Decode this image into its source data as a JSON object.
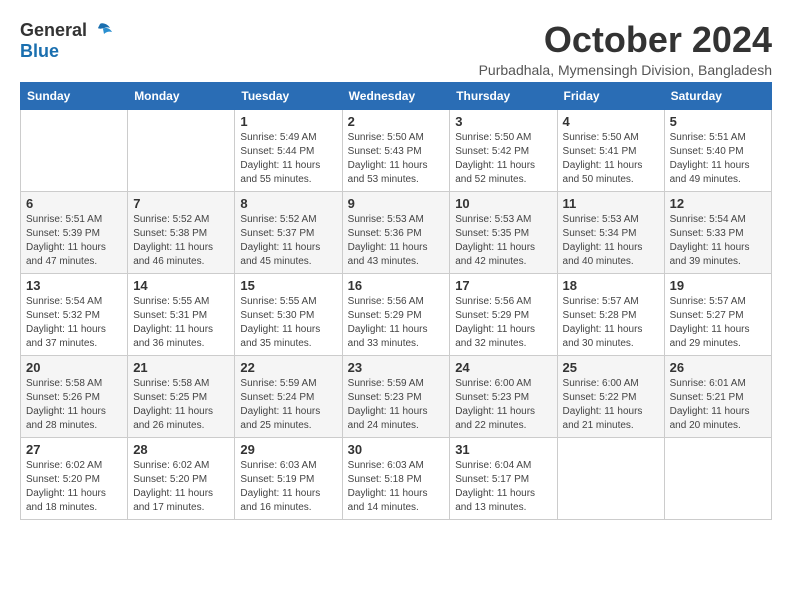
{
  "header": {
    "logo_general": "General",
    "logo_blue": "Blue",
    "month_title": "October 2024",
    "location": "Purbadhala, Mymensingh Division, Bangladesh"
  },
  "days_of_week": [
    "Sunday",
    "Monday",
    "Tuesday",
    "Wednesday",
    "Thursday",
    "Friday",
    "Saturday"
  ],
  "weeks": [
    [
      {
        "day": "",
        "info": ""
      },
      {
        "day": "",
        "info": ""
      },
      {
        "day": "1",
        "info": "Sunrise: 5:49 AM\nSunset: 5:44 PM\nDaylight: 11 hours\nand 55 minutes."
      },
      {
        "day": "2",
        "info": "Sunrise: 5:50 AM\nSunset: 5:43 PM\nDaylight: 11 hours\nand 53 minutes."
      },
      {
        "day": "3",
        "info": "Sunrise: 5:50 AM\nSunset: 5:42 PM\nDaylight: 11 hours\nand 52 minutes."
      },
      {
        "day": "4",
        "info": "Sunrise: 5:50 AM\nSunset: 5:41 PM\nDaylight: 11 hours\nand 50 minutes."
      },
      {
        "day": "5",
        "info": "Sunrise: 5:51 AM\nSunset: 5:40 PM\nDaylight: 11 hours\nand 49 minutes."
      }
    ],
    [
      {
        "day": "6",
        "info": "Sunrise: 5:51 AM\nSunset: 5:39 PM\nDaylight: 11 hours\nand 47 minutes."
      },
      {
        "day": "7",
        "info": "Sunrise: 5:52 AM\nSunset: 5:38 PM\nDaylight: 11 hours\nand 46 minutes."
      },
      {
        "day": "8",
        "info": "Sunrise: 5:52 AM\nSunset: 5:37 PM\nDaylight: 11 hours\nand 45 minutes."
      },
      {
        "day": "9",
        "info": "Sunrise: 5:53 AM\nSunset: 5:36 PM\nDaylight: 11 hours\nand 43 minutes."
      },
      {
        "day": "10",
        "info": "Sunrise: 5:53 AM\nSunset: 5:35 PM\nDaylight: 11 hours\nand 42 minutes."
      },
      {
        "day": "11",
        "info": "Sunrise: 5:53 AM\nSunset: 5:34 PM\nDaylight: 11 hours\nand 40 minutes."
      },
      {
        "day": "12",
        "info": "Sunrise: 5:54 AM\nSunset: 5:33 PM\nDaylight: 11 hours\nand 39 minutes."
      }
    ],
    [
      {
        "day": "13",
        "info": "Sunrise: 5:54 AM\nSunset: 5:32 PM\nDaylight: 11 hours\nand 37 minutes."
      },
      {
        "day": "14",
        "info": "Sunrise: 5:55 AM\nSunset: 5:31 PM\nDaylight: 11 hours\nand 36 minutes."
      },
      {
        "day": "15",
        "info": "Sunrise: 5:55 AM\nSunset: 5:30 PM\nDaylight: 11 hours\nand 35 minutes."
      },
      {
        "day": "16",
        "info": "Sunrise: 5:56 AM\nSunset: 5:29 PM\nDaylight: 11 hours\nand 33 minutes."
      },
      {
        "day": "17",
        "info": "Sunrise: 5:56 AM\nSunset: 5:29 PM\nDaylight: 11 hours\nand 32 minutes."
      },
      {
        "day": "18",
        "info": "Sunrise: 5:57 AM\nSunset: 5:28 PM\nDaylight: 11 hours\nand 30 minutes."
      },
      {
        "day": "19",
        "info": "Sunrise: 5:57 AM\nSunset: 5:27 PM\nDaylight: 11 hours\nand 29 minutes."
      }
    ],
    [
      {
        "day": "20",
        "info": "Sunrise: 5:58 AM\nSunset: 5:26 PM\nDaylight: 11 hours\nand 28 minutes."
      },
      {
        "day": "21",
        "info": "Sunrise: 5:58 AM\nSunset: 5:25 PM\nDaylight: 11 hours\nand 26 minutes."
      },
      {
        "day": "22",
        "info": "Sunrise: 5:59 AM\nSunset: 5:24 PM\nDaylight: 11 hours\nand 25 minutes."
      },
      {
        "day": "23",
        "info": "Sunrise: 5:59 AM\nSunset: 5:23 PM\nDaylight: 11 hours\nand 24 minutes."
      },
      {
        "day": "24",
        "info": "Sunrise: 6:00 AM\nSunset: 5:23 PM\nDaylight: 11 hours\nand 22 minutes."
      },
      {
        "day": "25",
        "info": "Sunrise: 6:00 AM\nSunset: 5:22 PM\nDaylight: 11 hours\nand 21 minutes."
      },
      {
        "day": "26",
        "info": "Sunrise: 6:01 AM\nSunset: 5:21 PM\nDaylight: 11 hours\nand 20 minutes."
      }
    ],
    [
      {
        "day": "27",
        "info": "Sunrise: 6:02 AM\nSunset: 5:20 PM\nDaylight: 11 hours\nand 18 minutes."
      },
      {
        "day": "28",
        "info": "Sunrise: 6:02 AM\nSunset: 5:20 PM\nDaylight: 11 hours\nand 17 minutes."
      },
      {
        "day": "29",
        "info": "Sunrise: 6:03 AM\nSunset: 5:19 PM\nDaylight: 11 hours\nand 16 minutes."
      },
      {
        "day": "30",
        "info": "Sunrise: 6:03 AM\nSunset: 5:18 PM\nDaylight: 11 hours\nand 14 minutes."
      },
      {
        "day": "31",
        "info": "Sunrise: 6:04 AM\nSunset: 5:17 PM\nDaylight: 11 hours\nand 13 minutes."
      },
      {
        "day": "",
        "info": ""
      },
      {
        "day": "",
        "info": ""
      }
    ]
  ]
}
